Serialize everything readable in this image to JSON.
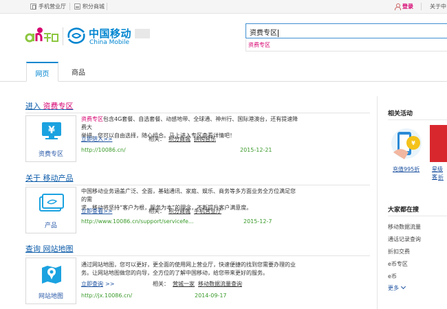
{
  "topbar": {
    "mobile_hall": "手机营业厅",
    "points_mall": "积分商城",
    "login": "登录",
    "about": "关于中"
  },
  "header": {
    "brand_cn": "中国移动",
    "brand_en": "China Mobile"
  },
  "search": {
    "value": "资费专区",
    "suggestion": "资费专区"
  },
  "tabs": [
    {
      "label": "网页",
      "active": true
    },
    {
      "label": "商品",
      "active": false
    }
  ],
  "results": [
    {
      "title_prefix": "进入",
      "title_main": "资费专区",
      "icon_caption": "资费专区",
      "desc_hl": "资费专区",
      "desc_line1_rest": "包含4G套餐、自选套餐、动感地带、全球通、神州行、国际港澳台，还有提速降费大",
      "desc_line2": "举措。您可以自由选择，随心组合。马上进入专区查看详情吧！",
      "more_link": "立即进入>>",
      "related_label": "相关：",
      "related": [
        "积分商城",
        "拼购音乐"
      ],
      "url": "http://10086.cn/",
      "date": "2015-12-21"
    },
    {
      "title_prefix": "关于",
      "title_main": "移动产品",
      "icon_caption": "产品",
      "desc_line1": "中国移动业务涵盖广泛、全面，基础通讯、家庭、娱乐、商务等多方面业务全方位满足您的需",
      "desc_line2": "求。移动将坚持“客户为根，服务为本”的理念，不断提升客户满意度。",
      "more_link": "立即查看>>",
      "related_label": "相关：",
      "related": [
        "积分商城",
        "手机营业厅"
      ],
      "url": "http://www.10086.cn/support/servicefe...",
      "date": "2015-12-7"
    },
    {
      "title_prefix": "查询",
      "title_main": "网站地图",
      "icon_caption": "网站地图",
      "desc_line1": "通过网站地图，您可以更好，更全面的使用网上营业厅，快速便捷的找到您需要办理的业",
      "desc_line2": "务。让网站地图做您的向导，全方位的了解中国移动，给您带来更好的服务。",
      "more_link": "立即查询",
      "more_arrows": ">>",
      "related_label": "相关：",
      "related": [
        "营城一家",
        "移动数据流量查询"
      ],
      "url": "http://jx.10086.cn/",
      "date": "2014-09-17"
    }
  ],
  "sidebar": {
    "activities_title": "相关活动",
    "promo1_caption": "充值995折",
    "promo2_caption_line1": "星级客",
    "promo2_caption_line2": "折",
    "hot_title": "大家都在搜",
    "hot_items": [
      "移动数据流量",
      "通话记录查询",
      "折扣交费",
      "e币专区",
      "e币"
    ],
    "more_label": "更多"
  },
  "colors": {
    "accent_blue": "#0085d0",
    "highlight_pink": "#d6006f",
    "url_green": "#3a9a2a"
  }
}
